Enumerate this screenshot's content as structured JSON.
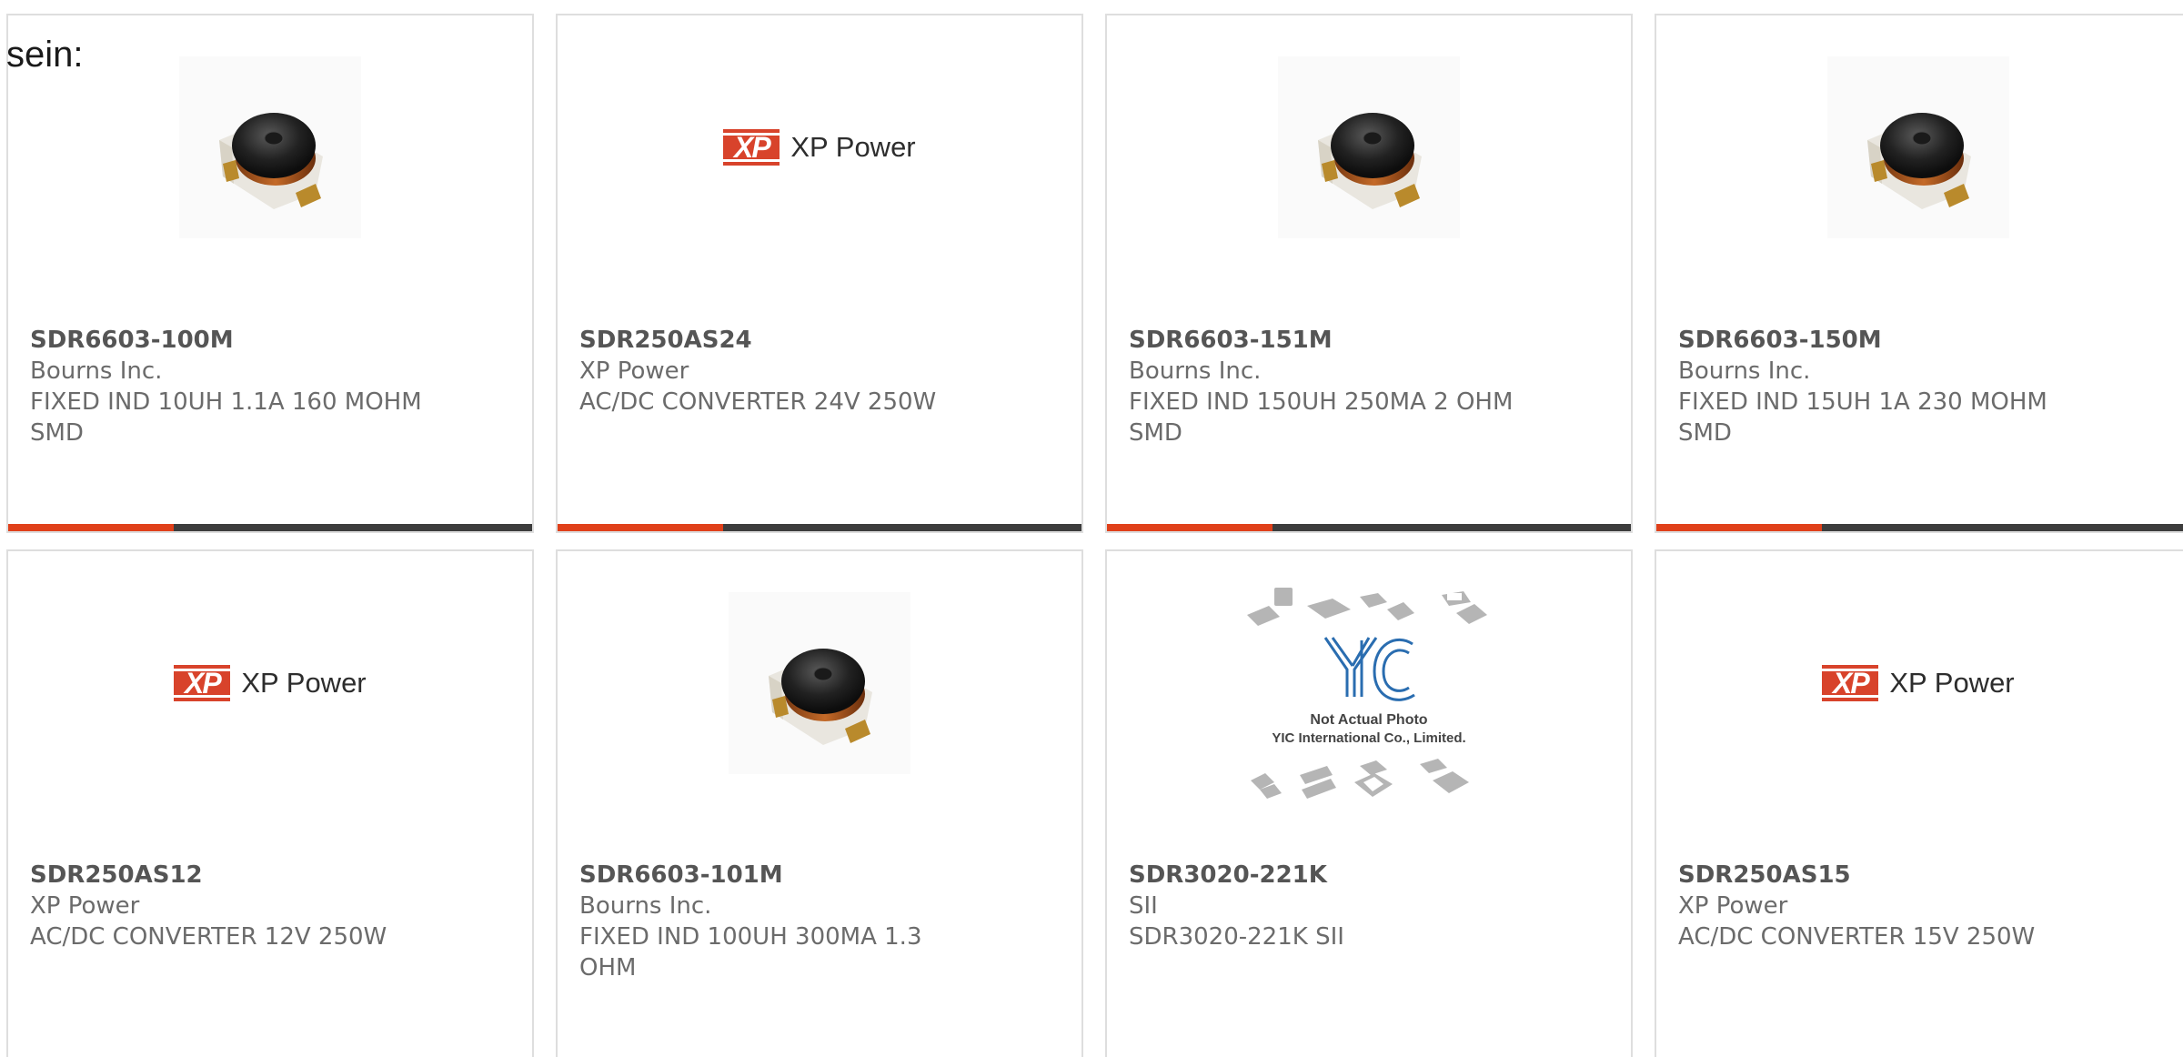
{
  "intro_text": "sein:",
  "colors": {
    "accent": "#e0401a",
    "bar": "#3d3d3d",
    "xp_red": "#d8432b"
  },
  "products": [
    {
      "part_number": "SDR6603-100M",
      "manufacturer": "Bourns Inc.",
      "description": "FIXED IND 10UH 1.1A 160 MOHM SMD",
      "image": "inductor-photo"
    },
    {
      "part_number": "SDR250AS24",
      "manufacturer": "XP Power",
      "description": "AC/DC CONVERTER 24V 250W",
      "image": "xp-power-logo"
    },
    {
      "part_number": "SDR6603-151M",
      "manufacturer": "Bourns Inc.",
      "description": "FIXED IND 150UH 250MA 2 OHM SMD",
      "image": "inductor-photo"
    },
    {
      "part_number": "SDR6603-150M",
      "manufacturer": "Bourns Inc.",
      "description": "FIXED IND 15UH 1A 230 MOHM SMD",
      "image": "inductor-photo"
    },
    {
      "part_number": "SDR250AS12",
      "manufacturer": "XP Power",
      "description": "AC/DC CONVERTER 12V 250W",
      "image": "xp-power-logo"
    },
    {
      "part_number": "SDR6603-101M",
      "manufacturer": "Bourns Inc.",
      "description": "FIXED IND 100UH 300MA 1.3 OHM",
      "image": "inductor-photo"
    },
    {
      "part_number": "SDR3020-221K",
      "manufacturer": "SII",
      "description": "SDR3020-221K SII",
      "image": "yic-placeholder"
    },
    {
      "part_number": "SDR250AS15",
      "manufacturer": "XP Power",
      "description": "AC/DC CONVERTER 15V 250W",
      "image": "xp-power-logo"
    }
  ],
  "xp_logo": {
    "mark": "XP",
    "wordmark": "XP Power"
  },
  "yic_placeholder": {
    "logo_text": "YIC",
    "line1": "Not Actual Photo",
    "line2": "YIC International Co., Limited."
  }
}
